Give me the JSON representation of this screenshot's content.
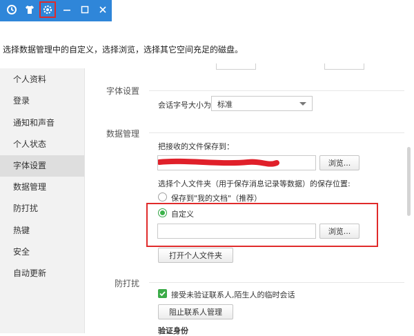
{
  "window": {
    "buttons": [
      {
        "name": "history-icon"
      },
      {
        "name": "shirt-skin-icon"
      },
      {
        "name": "gear-icon"
      },
      {
        "name": "minimize-icon"
      },
      {
        "name": "maximize-icon"
      },
      {
        "name": "close-icon"
      }
    ],
    "titlebar_color": "#2f86d9",
    "highlight_color": "#e02a2a"
  },
  "instruction": "选择数据管理中的自定义，选择浏览，选择其它空间充足的磁盘。",
  "sidebar": {
    "items": [
      {
        "label": "个人资料"
      },
      {
        "label": "登录"
      },
      {
        "label": "通知和声音"
      },
      {
        "label": "个人状态"
      },
      {
        "label": "字体设置",
        "active": true
      },
      {
        "label": "数据管理"
      },
      {
        "label": "防打扰"
      },
      {
        "label": "热键"
      },
      {
        "label": "安全"
      },
      {
        "label": "自动更新"
      }
    ]
  },
  "font_settings": {
    "section_title": "字体设置",
    "size_label": "会话字号大小为",
    "size_value": "标准"
  },
  "data_management": {
    "section_title": "数据管理",
    "save_files_label": "把接收的文件保存到：",
    "browse_label": "浏览...",
    "folder_choice_label": "选择个人文件夹（用于保存消息记录等数据）的保存位置:",
    "option_my_docs": "保存到\"我的文档\"（推荐）",
    "option_custom": "自定义",
    "custom_path_value": "",
    "browse_label_2": "浏览...",
    "open_folder_button": "打开个人文件夹"
  },
  "do_not_disturb": {
    "section_title": "防打扰",
    "accept_checkbox_label": "接受未验证联系人,陌生人的临时会话",
    "block_button": "阻止联系人管理",
    "verify_title": "验证身份"
  }
}
